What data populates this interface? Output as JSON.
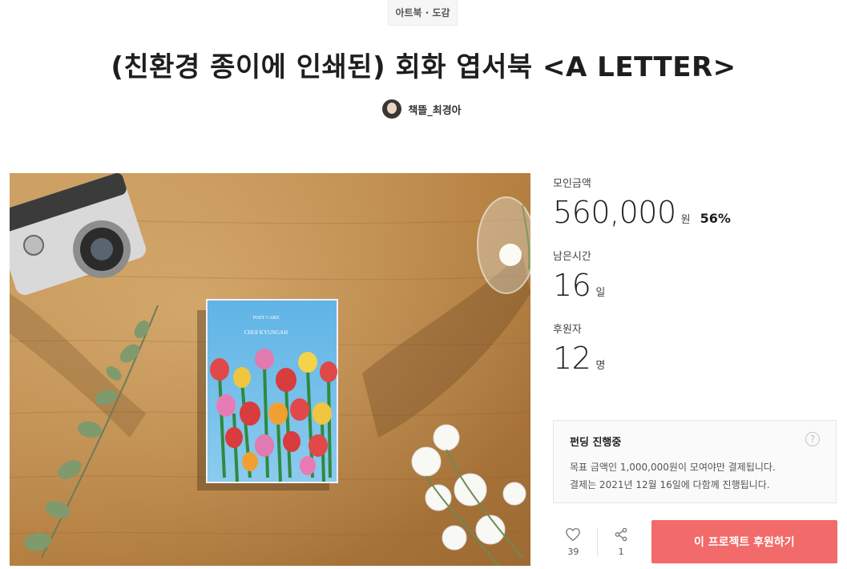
{
  "category": "아트북 · 도감",
  "title": "(친환경 종이에 인쇄된) 회화 엽서북 <A LETTER>",
  "creator": {
    "name": "책뜰_최경아"
  },
  "stats": {
    "amount_label": "모인금액",
    "amount_value": "560,000",
    "amount_unit": "원",
    "amount_percent": "56%",
    "time_label": "남은시간",
    "time_value": "16",
    "time_unit": "일",
    "backers_label": "후원자",
    "backers_value": "12",
    "backers_unit": "명"
  },
  "funding": {
    "title": "펀딩 진행중",
    "line1": "목표 금액인 1,000,000원이 모여야만 결제됩니다.",
    "line2": "결제는 2021년 12월 16일에 다함께 진행됩니다.",
    "help_icon": "question-circle-icon"
  },
  "actions": {
    "like_count": "39",
    "share_count": "1",
    "back_label": "이 프로젝트 후원하기"
  },
  "book": {
    "cover_line1": "POST CARD",
    "cover_line2": "CHOI KYUNGAH"
  },
  "colors": {
    "accent": "#f26a6a",
    "wood": "#b78445"
  }
}
